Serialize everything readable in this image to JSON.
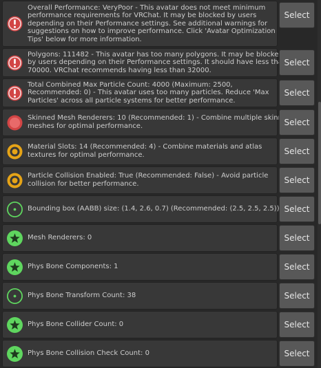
{
  "button_label": "Select",
  "colors": {
    "error": "#d24545",
    "warning": "#e6a417",
    "good": "#5fd65f"
  },
  "rows": [
    {
      "severity": "error",
      "icon": "exclamation-icon",
      "lines": [
        "Overall Performance: VeryPoor - This avatar does not meet minimum",
        "performance requirements for VRChat. It may be blocked by users",
        "depending on their Performance settings. See additional warnings for",
        "suggestions on how to improve performance. Click 'Avatar Optimization",
        "Tips' below for more information."
      ]
    },
    {
      "severity": "error",
      "icon": "exclamation-icon",
      "lines": [
        "Polygons: 111482 - This avatar has too many polygons. It may be blocked",
        "by users depending on their Performance settings. It should have less than",
        "70000. VRChat recommends having less than 32000."
      ]
    },
    {
      "severity": "error",
      "icon": "exclamation-icon",
      "lines": [
        "Total Combined Max Particle Count: 4000 (Maximum: 2500,",
        "Recommended: 0) - This avatar uses too many particles. Reduce 'Max",
        "Particles' across all particle systems for better performance."
      ]
    },
    {
      "severity": "error",
      "icon": "filled-circle-icon",
      "lines": [
        "Skinned Mesh Renderers: 10 (Recommended: 1) - Combine multiple skinned",
        "meshes for optimal performance."
      ]
    },
    {
      "severity": "warning",
      "icon": "ring-circle-icon",
      "lines": [
        "Material Slots: 14 (Recommended: 4) - Combine materials and atlas",
        "textures for optimal performance."
      ]
    },
    {
      "severity": "warning",
      "icon": "ring-circle-icon",
      "lines": [
        "Particle Collision Enabled: True (Recommended: False) - Avoid particle",
        "collision for better performance."
      ]
    },
    {
      "severity": "good",
      "icon": "dot-circle-icon",
      "lines": [
        "Bounding box (AABB) size: (1.4, 2.6, 0.7) (Recommended: (2.5, 2.5, 2.5))"
      ]
    },
    {
      "severity": "good",
      "icon": "star-icon",
      "lines": [
        "Mesh Renderers: 0"
      ]
    },
    {
      "severity": "good",
      "icon": "star-icon",
      "lines": [
        "Phys Bone Components: 1"
      ]
    },
    {
      "severity": "good",
      "icon": "dot-circle-icon",
      "lines": [
        "Phys Bone Transform Count: 38"
      ]
    },
    {
      "severity": "good",
      "icon": "star-icon",
      "lines": [
        "Phys Bone Collider Count: 0"
      ]
    },
    {
      "severity": "good",
      "icon": "star-icon",
      "lines": [
        "Phys Bone Collision Check Count: 0"
      ]
    }
  ]
}
